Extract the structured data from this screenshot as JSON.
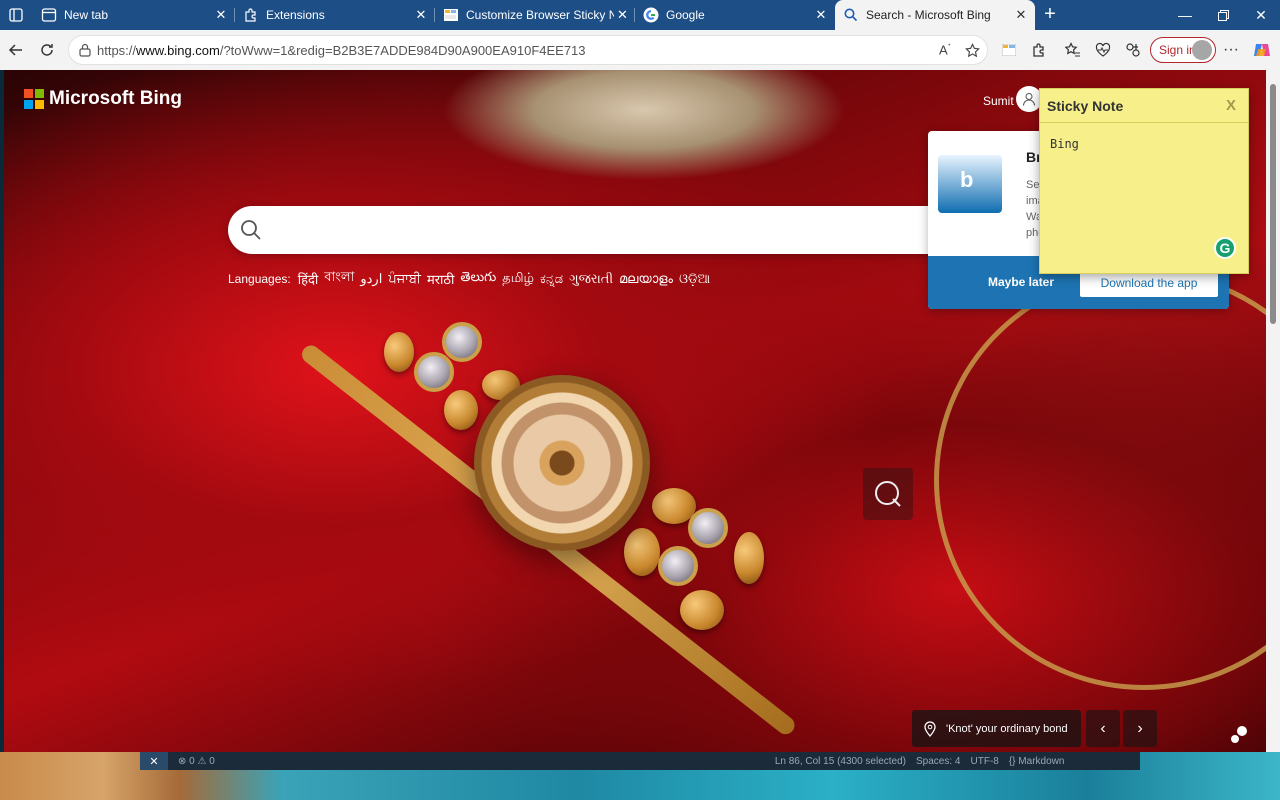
{
  "tabs": [
    {
      "title": "New tab",
      "icon": "new-tab-icon",
      "active": false
    },
    {
      "title": "Extensions",
      "icon": "puzzle-icon",
      "active": false
    },
    {
      "title": "Customize Browser Sticky Notes",
      "icon": "sticky-notes-icon",
      "active": false
    },
    {
      "title": "Google",
      "icon": "google-icon",
      "active": false
    },
    {
      "title": "Search - Microsoft Bing",
      "icon": "search-icon",
      "active": true
    }
  ],
  "toolbar": {
    "url_prefix": "https://",
    "url_host": "www.bing.com",
    "url_path": "/?toWww=1&redig=B2B3E7ADDE984D90A900EA910F4EE713",
    "signin_label": "Sign in"
  },
  "bing": {
    "logo_text": "Microsoft Bing",
    "user_name": "Sumit",
    "languages_label": "Languages:",
    "languages": [
      "हिंदी",
      "বাংলা",
      "اردو",
      "ਪੰਜਾਬੀ",
      "मराठी",
      "తెలుగు",
      "தமிழ்",
      "ಕನ್ನಡ",
      "ગુજરાતી",
      "മലയാളം",
      "ଓଡ଼ିଆ"
    ],
    "caption": "'Knot' your ordinary bond"
  },
  "promo": {
    "title": "Br",
    "text_lines": [
      "Se",
      "ima",
      "Wa",
      "pho"
    ],
    "later_label": "Maybe later",
    "download_label": "Download the app"
  },
  "sticky": {
    "title": "Sticky Note",
    "close_label": "X",
    "body": "Bing"
  },
  "statusbar": {
    "close_label": "✕",
    "problems": "⊗ 0 ⚠ 0",
    "position": "Ln 86, Col 15 (4300 selected)",
    "spaces": "Spaces: 4",
    "encoding": "UTF-8",
    "language": "{} Markdown"
  },
  "colors": {
    "tabstrip": "#1d4e86",
    "toolbar": "#f3f3f3",
    "promo_footer": "#1e74b3",
    "sticky_bg": "#f7ef8a",
    "signin_accent": "#b3262d"
  }
}
